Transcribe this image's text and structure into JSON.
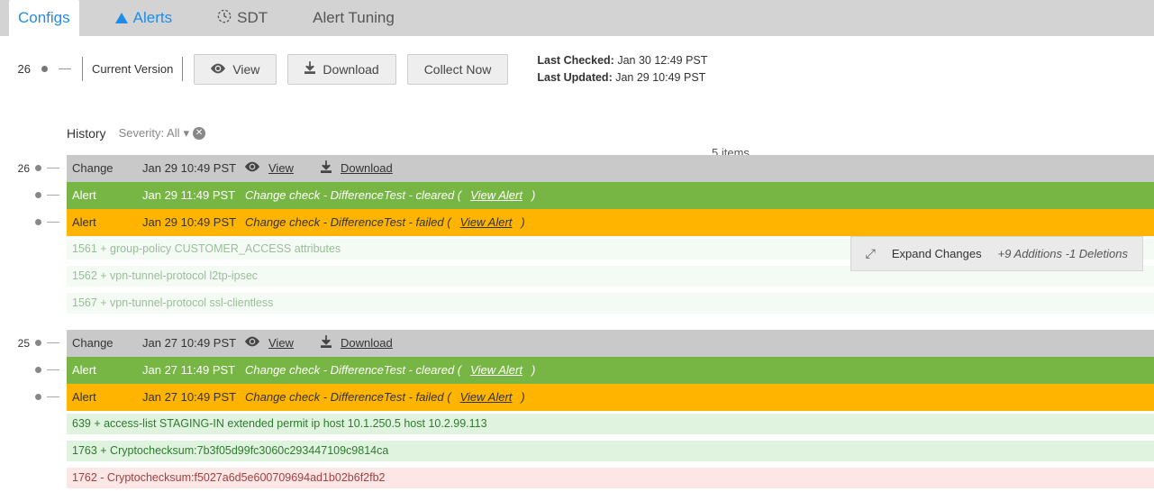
{
  "tabs": {
    "configs": "Configs",
    "alerts": "Alerts",
    "sdt": "SDT",
    "tuning": "Alert Tuning"
  },
  "toolbar": {
    "version_number": "26",
    "current_version_label": "Current Version",
    "view_btn": "View",
    "download_btn": "Download",
    "collect_btn": "Collect Now",
    "last_checked_label": "Last Checked:",
    "last_checked_value": "Jan 30 12:49 PST",
    "last_updated_label": "Last Updated:",
    "last_updated_value": "Jan 29 10:49 PST"
  },
  "history": {
    "label": "History",
    "severity_label": "Severity: All",
    "items_count": "5 items"
  },
  "expand": {
    "label": "Expand Changes",
    "stats": "+9 Additions -1 Deletions"
  },
  "group1": {
    "ver": "26",
    "change_label": "Change",
    "change_time": "Jan 29 10:49 PST",
    "view": "View",
    "download": "Download",
    "alert1_label": "Alert",
    "alert1_time": "Jan 29 11:49 PST",
    "alert1_text": "Change check - DifferenceTest - cleared  (",
    "alert1_link": "View Alert",
    "alert1_close": ")",
    "alert2_label": "Alert",
    "alert2_time": "Jan 29 10:49 PST",
    "alert2_text": "Change check - DifferenceTest - failed  (",
    "alert2_link": "View Alert",
    "alert2_close": ")",
    "diff1": "1561 + group-policy CUSTOMER_ACCESS attributes",
    "diff2": "1562 + vpn-tunnel-protocol l2tp-ipsec",
    "diff3": "1567 + vpn-tunnel-protocol ssl-clientless"
  },
  "group2": {
    "ver": "25",
    "change_label": "Change",
    "change_time": "Jan 27 10:49 PST",
    "view": "View",
    "download": "Download",
    "alert1_label": "Alert",
    "alert1_time": "Jan 27 11:49 PST",
    "alert1_text": "Change check - DifferenceTest - cleared  (",
    "alert1_link": "View Alert",
    "alert1_close": ")",
    "alert2_label": "Alert",
    "alert2_time": "Jan 27 10:49 PST",
    "alert2_text": "Change check - DifferenceTest - failed  (",
    "alert2_link": "View Alert",
    "alert2_close": ")",
    "diff1": "639 + access-list STAGING-IN extended permit ip host 10.1.250.5 host 10.2.99.113",
    "diff2": "1763 + Cryptochecksum:7b3f05d99fc3060c293447109c9814ca",
    "diff3": "1762 - Cryptochecksum:f5027a6d5e600709694ad1b02b6f2fb2"
  }
}
